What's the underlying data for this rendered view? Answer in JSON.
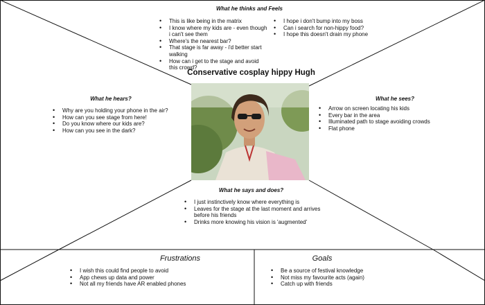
{
  "persona": {
    "name": "Conservative cosplay hippy Hugh"
  },
  "thinks_feels": {
    "heading": "What he thinks and Feels",
    "items_left": [
      "This is like being in the matrix",
      "I know where my kids are - even though i can't see them",
      "Where's the nearest bar?",
      "That stage is far away - i'd better start walking",
      "How can i get to the stage and avoid this crowd?"
    ],
    "items_right": [
      "I hope i don't bump into my boss",
      "Can i search for non-hippy food?",
      "I hope this doesn't drain my phone"
    ]
  },
  "hears": {
    "heading": "What he hears?",
    "items": [
      "Why are you holding your phone in the air?",
      "How can you see stage from here!",
      "Do you know where our kids are?",
      "How can you see in the dark?"
    ]
  },
  "sees": {
    "heading": "What he sees?",
    "items": [
      "Arrow on screen locating his kids",
      "Every bar in the area",
      "Illuminated path to stage avoiding crowds",
      "Flat phone"
    ]
  },
  "says_does": {
    "heading": "What he says and does?",
    "items": [
      "I just instinctively know where everything is",
      "Leaves for the stage at the last moment and arrives before his friends",
      "Drinks more knowing his vision is 'augmented'"
    ]
  },
  "frustrations": {
    "heading": "Frustrations",
    "items": [
      "I wish this could find people to avoid",
      "App chews up data and power",
      "Not all my friends have AR enabled phones"
    ]
  },
  "goals": {
    "heading": "Goals",
    "items": [
      "Be a source of festival knowledge",
      "Not miss my favourite acts (again)",
      "Catch up with friends"
    ]
  }
}
